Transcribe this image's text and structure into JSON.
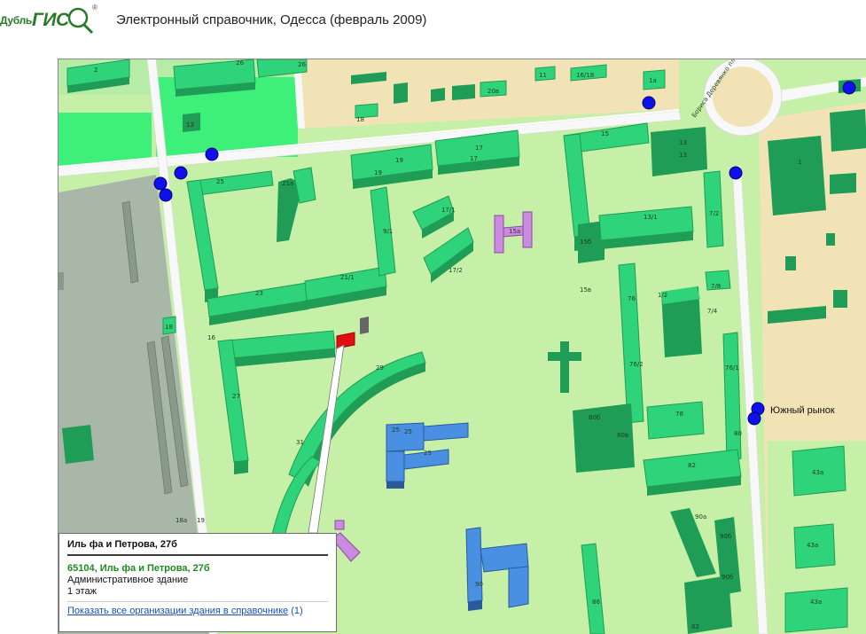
{
  "header": {
    "logo_prefix": "Дубль",
    "logo_main": "ГИС",
    "logo_reg": "®",
    "title": "Электронный справочник, Одесса (февраль 2009)"
  },
  "map": {
    "square_label": "Бориса Деревянко площадь",
    "poi_label": "Южный рынок",
    "building_labels": [
      "26",
      "26",
      "2",
      "13",
      "18",
      "20в",
      "11",
      "16/18",
      "1а",
      "15",
      "13",
      "13",
      "1",
      "25",
      "21а",
      "19",
      "19",
      "17",
      "17",
      "9/1",
      "17/1",
      "17/2",
      "15а",
      "15б",
      "13/1",
      "7/2",
      "21/1",
      "23",
      "7/4",
      "7/8",
      "25",
      "1/2",
      "18",
      "27",
      "29",
      "31",
      "25",
      "25",
      "16",
      "15в",
      "76",
      "76/2",
      "80б",
      "80",
      "80в",
      "78",
      "76/1",
      "82",
      "43а",
      "43а",
      "43а",
      "90",
      "90а",
      "90б",
      "90б",
      "86",
      "82",
      "18а",
      "19"
    ]
  },
  "popup": {
    "title": "Иль фа и Петрова, 27б",
    "address": "65104, Иль фа и Петрова, 27б",
    "type": "Административное здание",
    "floors": "1 этаж",
    "link": "Показать все организации здания в справочнике",
    "link_count": "(1)"
  },
  "colors": {
    "park": "#c6f0a8",
    "building_top": "#2fd37a",
    "building_side": "#1f9c55",
    "building_dark": "#127a3f",
    "selected": "#e01010",
    "public": "#4a90e2",
    "special": "#c98ae0",
    "bus_stop": "#1010ee",
    "road": "#f8f8f8",
    "sand": "#f1e3b6",
    "rail": "#a9b7a9"
  }
}
